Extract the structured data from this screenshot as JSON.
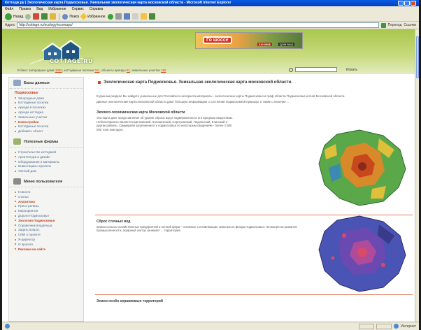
{
  "window": {
    "title": "Коттедж.ру | Экологическая карта Подмосковья. Уникальная экологическая карта московской области - Microsoft Internet Explorer"
  },
  "menu": [
    "Файл",
    "Правка",
    "Вид",
    "Избранное",
    "Сервис",
    "Справка"
  ],
  "toolbar": {
    "back": "Назад",
    "search": "Поиск",
    "favorites": "Избранное"
  },
  "address": {
    "label": "Адрес",
    "url": "http://cottage.ru/ecology/ecomaps/",
    "go": "Переход",
    "links": "Ссылки"
  },
  "site": {
    "logo": "COTTAGE.RU",
    "banner": {
      "headline": "Го шоссе",
      "price": "210 000$",
      "house": "ДОМ ВАШ"
    },
    "stats": {
      "prefix": "В базе:",
      "items": [
        {
          "label": "загородные дома",
          "value": "3085"
        },
        {
          "label": "коттеджные поселки",
          "value": "311"
        },
        {
          "label": "объекты аренды",
          "value": "81"
        },
        {
          "label": "земельные участки",
          "value": "190"
        }
      ]
    },
    "search_btn": "Искать"
  },
  "sidebar": {
    "sections": [
      {
        "title": "Базы данных",
        "color": "#8fa4c7",
        "items": [
          {
            "label": "Подмосковье",
            "type": "hdr"
          },
          {
            "label": "Загородные дома"
          },
          {
            "label": "Коттеджные поселки"
          },
          {
            "label": "Аренда в поселках"
          },
          {
            "label": "Аренда коттеджа"
          },
          {
            "label": "Земельные участки"
          },
          {
            "label": "Новостройки",
            "type": "red"
          },
          {
            "label": "Коттеджные поселки"
          },
          {
            "label": "Добавить объект"
          }
        ]
      },
      {
        "title": "Полезные фирмы",
        "color": "#9ab36a",
        "items": [
          {
            "label": "Строительство коттеджей"
          },
          {
            "label": "Архитектура и дизайн"
          },
          {
            "label": "Оборудование и материалы"
          },
          {
            "label": "Инвестиции и проекты"
          },
          {
            "label": "Уютный дом"
          }
        ]
      },
      {
        "title": "Меню пользователя",
        "color": "#8a8a8a",
        "items": [
          {
            "label": "Новости"
          },
          {
            "label": "Статьи"
          },
          {
            "label": "Аналитика",
            "type": "red"
          },
          {
            "label": "Пресс-релизы"
          },
          {
            "label": "Мероприятия"
          },
          {
            "label": "Дороги Подмосковья"
          },
          {
            "label": "Экология Подмосковья",
            "type": "red"
          },
          {
            "label": "Справочник владельца"
          },
          {
            "label": "Задать вопрос"
          },
          {
            "label": "СМИ о проекте"
          },
          {
            "label": "Я-директор"
          },
          {
            "label": "О проекте"
          },
          {
            "label": "Реклама на сайте",
            "type": "hot"
          }
        ]
      }
    ]
  },
  "content": {
    "title": "Экологическая карта Подмосковья. Уникальная экологическая карта московской области.",
    "intro1": "В данном разделе Вы найдете уникальные для Российского интернета материалы - экологические карты Подмосковья и граф области Подмосковья и всей Московской области.",
    "intro2": "Данные экологические карты московской области дают большую информацию о состоянии подмосковной природы, а также о наличии ...",
    "sec1_title": "Эколого-геохимическая карта Московской области",
    "sec1_text": "Эта карта дает представление об уровне сброса вод и подверженности его вредным веществам. Неблагоприятно является Щёлковский, Коломенский, Серпуховский, Подольский, Клинский и другие районы. Суммарная загрязненность подмосковья по некоторым сведениям - более 2 500 000 тонн ежегодно.",
    "sec2_title": "Сброс сточных вод",
    "sec2_text": "Земли сельско-хозяйственных предприятий и личной форм - основные составляющие земельного фонда Подмосковья. Несмотря на развитие промышленности, аграрный сектор занимает ... территорий.",
    "sec3_title": "Земли особо охраняемых территорий"
  },
  "status": {
    "zone": "Интернет"
  }
}
